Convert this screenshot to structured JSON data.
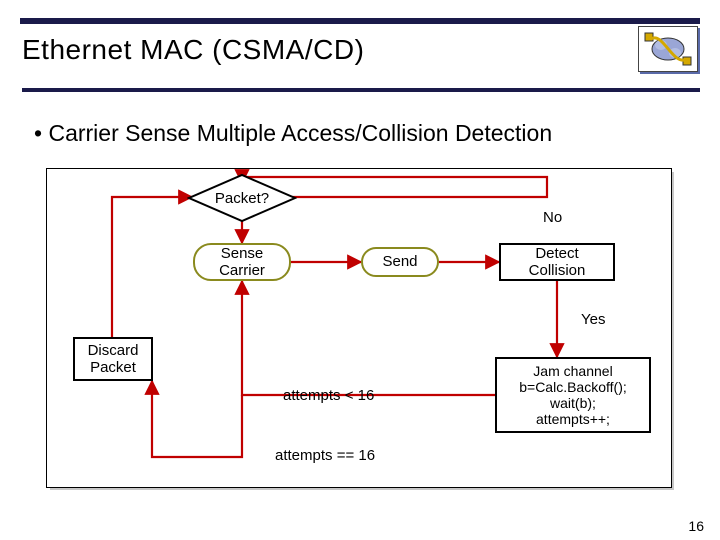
{
  "title": "Ethernet MAC (CSMA/CD)",
  "bullet": "Carrier Sense Multiple Access/Collision Detection",
  "nodes": {
    "packet": "Packet?",
    "sense": "Sense\nCarrier",
    "send": "Send",
    "detect": "Detect\nCollision",
    "jam": "Jam channel\nb=Calc.Backoff();\nwait(b);\nattempts++;",
    "discard": "Discard\nPacket"
  },
  "labels": {
    "no": "No",
    "yes": "Yes",
    "att_lt": "attempts < 16",
    "att_eq": "attempts == 16"
  },
  "page_number": "16"
}
